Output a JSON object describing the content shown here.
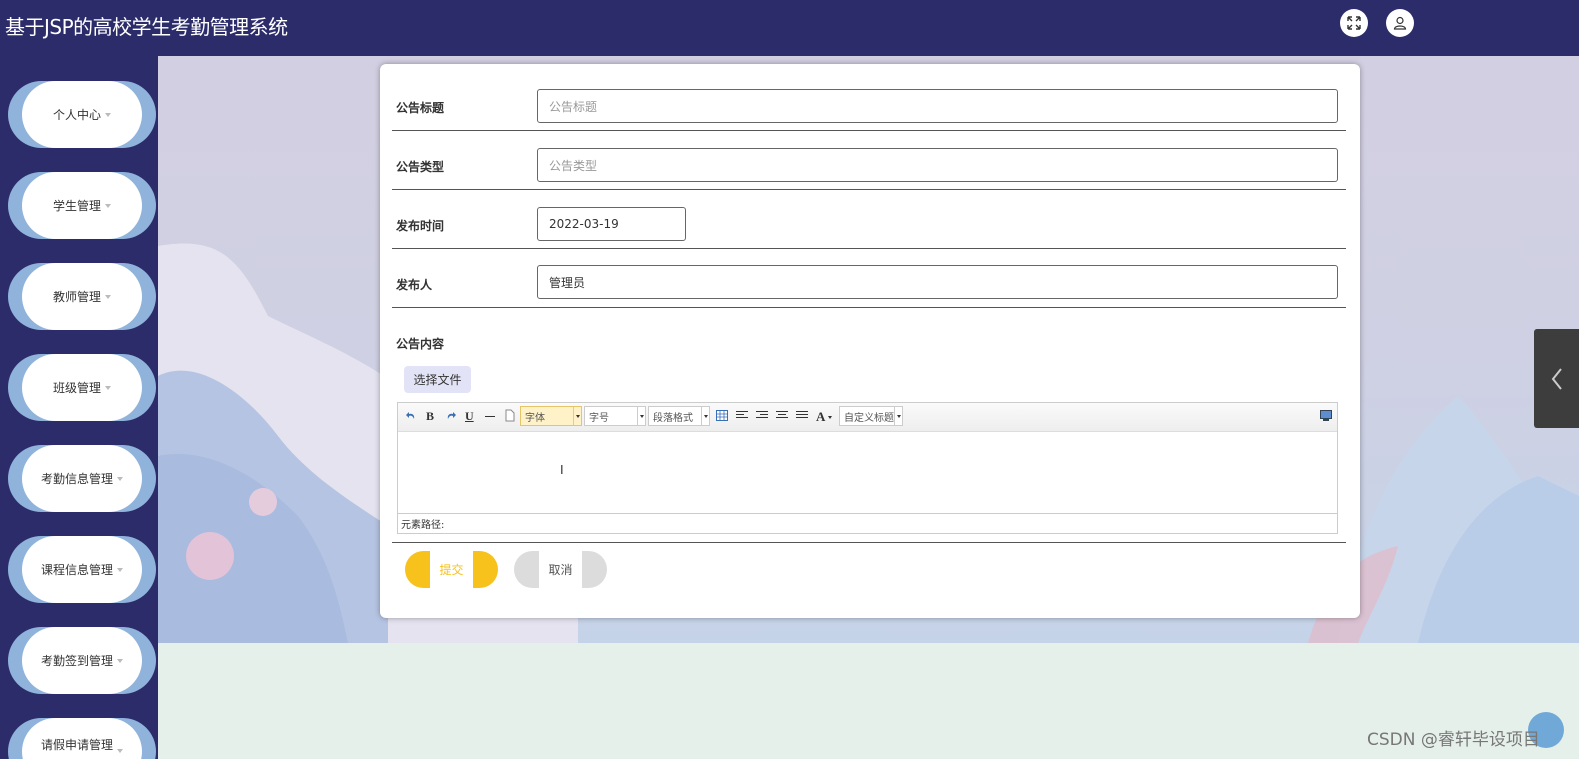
{
  "header": {
    "title": "基于JSP的高校学生考勤管理系统",
    "fullscreen_icon": "expand-icon",
    "user_icon": "user-icon"
  },
  "sidebar": {
    "items": [
      {
        "label": "个人中心"
      },
      {
        "label": "学生管理"
      },
      {
        "label": "教师管理"
      },
      {
        "label": "班级管理"
      },
      {
        "label": "考勤信息管理"
      },
      {
        "label": "课程信息管理"
      },
      {
        "label": "考勤签到管理"
      },
      {
        "label": "请假申请管理"
      }
    ]
  },
  "form": {
    "title": {
      "label": "公告标题",
      "value": "",
      "placeholder": "公告标题"
    },
    "type": {
      "label": "公告类型",
      "value": "",
      "placeholder": "公告类型"
    },
    "time": {
      "label": "发布时间",
      "value": "2022-03-19"
    },
    "publisher": {
      "label": "发布人",
      "value": "管理员"
    },
    "content": {
      "label": "公告内容",
      "file_button": "选择文件"
    }
  },
  "editor": {
    "bold": "B",
    "underline": "U",
    "font_family": "字体",
    "font_size": "字号",
    "paragraph": "段落格式",
    "font_color": "A",
    "custom_title": "自定义标题",
    "path_label": "元素路径:"
  },
  "actions": {
    "submit": "提交",
    "cancel": "取消"
  },
  "watermark": "CSDN @睿轩毕设项目"
}
